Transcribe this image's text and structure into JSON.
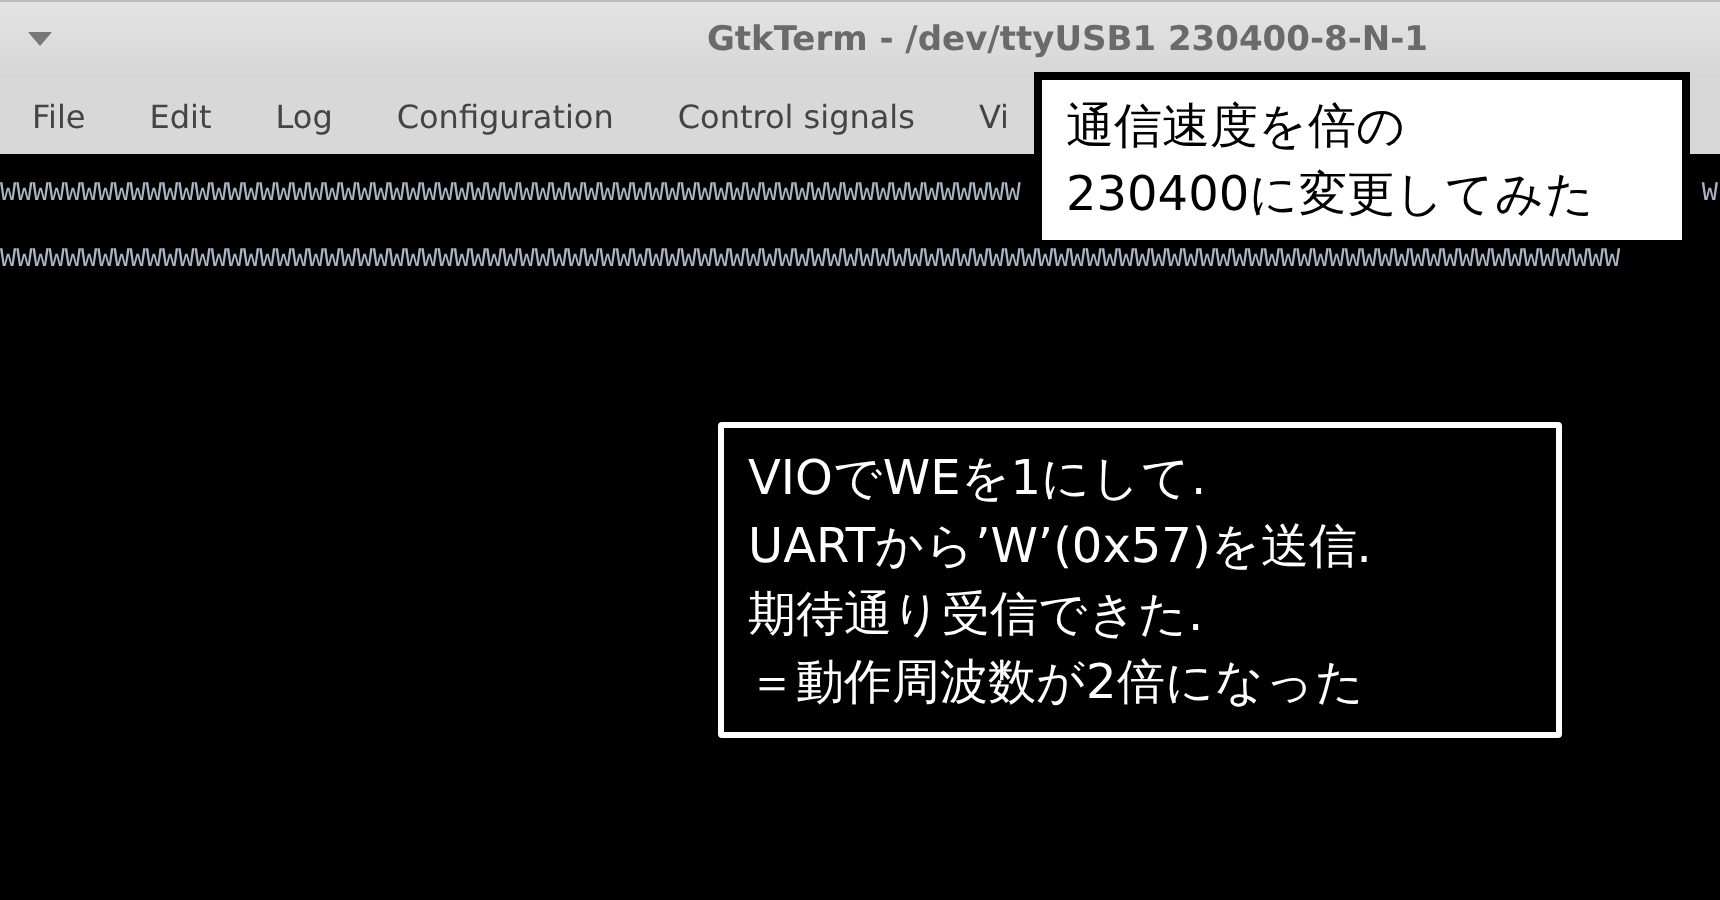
{
  "window": {
    "title": "GtkTerm - /dev/ttyUSB1  230400-8-N-1"
  },
  "menu": [
    "File",
    "Edit",
    "Log",
    "Configuration",
    "Control signals",
    "Vi"
  ],
  "terminal": {
    "lines": [
      {
        "segments": [
          "WWWWWWWWWWWWWWWWWWWWWWWWWWWWWWWWWWWWWWWWWWWWWWWWWWWWWWWWWWWWWWW",
          "W"
        ]
      },
      {
        "segments": [
          "WWWWWWWWWWWWWWWWWWWWWWWWWWWWWWWWWWWWWWWWWWWWWWWWWWWWWWWWWWWWWWWWWWWWWWWWWWWWWWWWWWWWWWWWWWWWWWWWWWWW"
        ]
      }
    ]
  },
  "callouts": [
    {
      "kind": "light",
      "lines": [
        "通信速度を倍の",
        "230400に変更してみた"
      ]
    },
    {
      "kind": "dark",
      "lines": [
        "VIOでWEを1にして.",
        "UARTから’W’(0x57)を送信.",
        "期待通り受信できた.",
        "＝動作周波数が2倍になった"
      ]
    }
  ]
}
